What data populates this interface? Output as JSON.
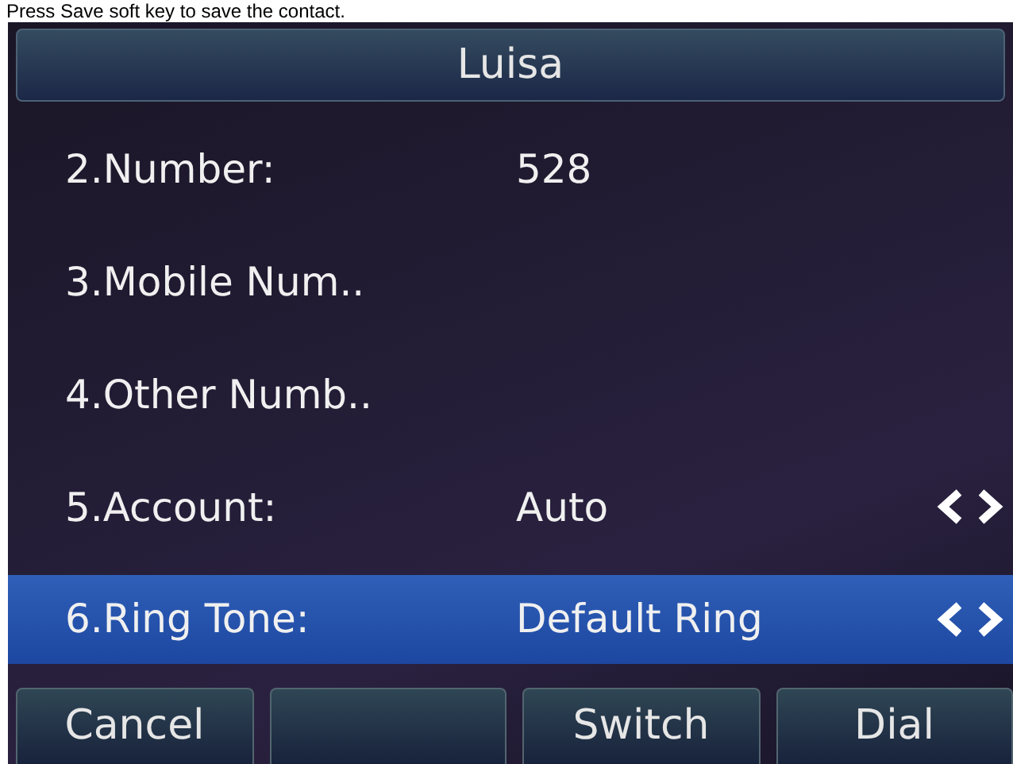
{
  "caption": "Press Save soft key to save the contact.",
  "title": "Luisa",
  "fields": [
    {
      "label": "2.Number:",
      "value": "528",
      "selected": false,
      "kind": "text"
    },
    {
      "label": "3.Mobile Num..",
      "selected": false,
      "kind": "text"
    },
    {
      "label": "4.Other Numb..",
      "selected": false,
      "kind": "text"
    },
    {
      "label": "5.Account:",
      "value": "Auto",
      "selected": false,
      "kind": "choice"
    },
    {
      "label": "6.Ring Tone:",
      "value": "Default Ring",
      "selected": true,
      "kind": "choice"
    }
  ],
  "softkeys": [
    {
      "kind": "label",
      "label": "Cancel"
    },
    {
      "kind": "blank"
    },
    {
      "kind": "label",
      "label": "Switch"
    },
    {
      "kind": "label",
      "label": "Dial"
    }
  ]
}
